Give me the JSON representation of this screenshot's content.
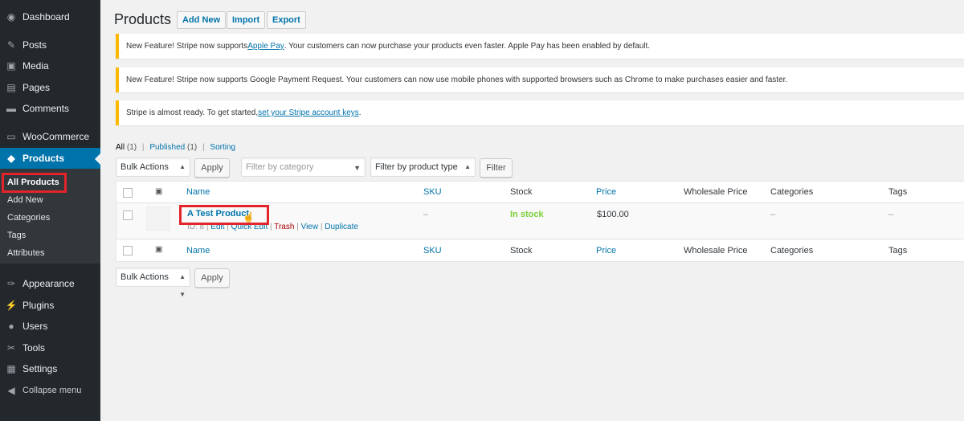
{
  "sidebar": {
    "items": [
      {
        "label": "Dashboard",
        "icon": "dashboard-icon",
        "glyph": "◉"
      },
      {
        "label": "Posts",
        "icon": "pin-icon",
        "glyph": "✎"
      },
      {
        "label": "Media",
        "icon": "media-icon",
        "glyph": "▣"
      },
      {
        "label": "Pages",
        "icon": "pages-icon",
        "glyph": "▤"
      },
      {
        "label": "Comments",
        "icon": "comments-icon",
        "glyph": "▬"
      },
      {
        "label": "WooCommerce",
        "icon": "woocommerce-icon",
        "glyph": "▭"
      },
      {
        "label": "Products",
        "icon": "products-icon",
        "glyph": "◆"
      },
      {
        "label": "Appearance",
        "icon": "brush-icon",
        "glyph": "✑"
      },
      {
        "label": "Plugins",
        "icon": "plug-icon",
        "glyph": "⚡"
      },
      {
        "label": "Users",
        "icon": "user-icon",
        "glyph": "●"
      },
      {
        "label": "Tools",
        "icon": "wrench-icon",
        "glyph": "✂"
      },
      {
        "label": "Settings",
        "icon": "settings-icon",
        "glyph": "▦"
      },
      {
        "label": "Collapse menu",
        "icon": "collapse-icon",
        "glyph": "◀"
      }
    ],
    "submenu": [
      "All Products",
      "Add New",
      "Categories",
      "Tags",
      "Attributes"
    ]
  },
  "header": {
    "title": "Products",
    "buttons": [
      "Add New",
      "Import",
      "Export"
    ]
  },
  "notices": {
    "n1_pre": "New Feature! Stripe now supports ",
    "n1_link": "Apple Pay",
    "n1_post": ". Your customers can now purchase your products even faster. Apple Pay has been enabled by default.",
    "n2": "New Feature! Stripe now supports Google Payment Request. Your customers can now use mobile phones with supported browsers such as Chrome to make purchases easier and faster.",
    "n3_pre": "Stripe is almost ready. To get started, ",
    "n3_link": "set your Stripe account keys",
    "n3_post": "."
  },
  "views": {
    "all": "All",
    "all_count": "(1)",
    "published": "Published",
    "published_count": "(1)",
    "sorting": "Sorting",
    "sep": "|"
  },
  "filters": {
    "bulk_actions": "Bulk Actions",
    "apply": "Apply",
    "category_placeholder": "Filter by category",
    "product_type": "Filter by product type",
    "filter": "Filter"
  },
  "table": {
    "columns": [
      "Name",
      "SKU",
      "Stock",
      "Price",
      "Wholesale Price",
      "Categories",
      "Tags"
    ],
    "row": {
      "name": "A Test Product",
      "id": "ID: 8",
      "actions": [
        "Edit",
        "Quick Edit",
        "Trash",
        "View",
        "Duplicate"
      ],
      "sku": "–",
      "stock": "In stock",
      "price": "$100.00",
      "wholesale": "",
      "categories": "–",
      "tags": "–"
    }
  },
  "colors": {
    "sidebar_bg": "#23282d",
    "active": "#0073aa",
    "notice_border": "#ffb900",
    "in_stock": "#7ad03a",
    "highlight": "#e3242b"
  }
}
